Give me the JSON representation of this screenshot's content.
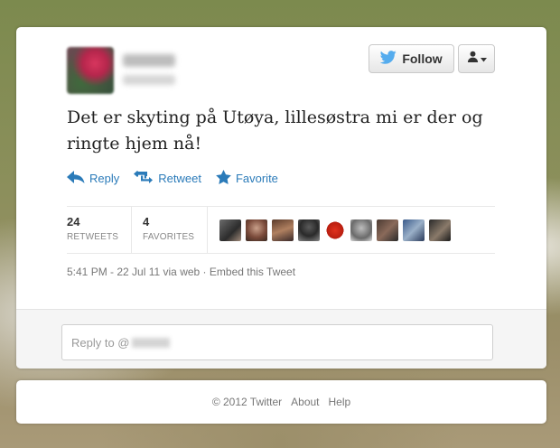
{
  "tweet": {
    "text": "Det er skyting på Utøya, lillesøstra mi er der og ringte hjem nå!",
    "follow_label": "Follow",
    "actions": {
      "reply": "Reply",
      "retweet": "Retweet",
      "favorite": "Favorite"
    },
    "stats": {
      "retweets_count": "24",
      "retweets_label": "RETWEETS",
      "favorites_count": "4",
      "favorites_label": "FAVORITES"
    },
    "meta": {
      "timestamp": "5:41 PM - 22 Jul 11",
      "via": "via web",
      "separator": "·",
      "embed": "Embed this Tweet"
    }
  },
  "reply_box": {
    "placeholder": "Reply to @"
  },
  "footer": {
    "copyright": "© 2012 Twitter",
    "about": "About",
    "help": "Help"
  },
  "icons": {
    "follow": "twitter-bird-icon",
    "user_menu": "user-icon",
    "reply": "reply-arrow-icon",
    "retweet": "retweet-icon",
    "favorite": "star-icon"
  },
  "colors": {
    "link": "#2b7bb9",
    "twitter_blue": "#55acee",
    "text": "#222222",
    "muted": "#777777"
  }
}
